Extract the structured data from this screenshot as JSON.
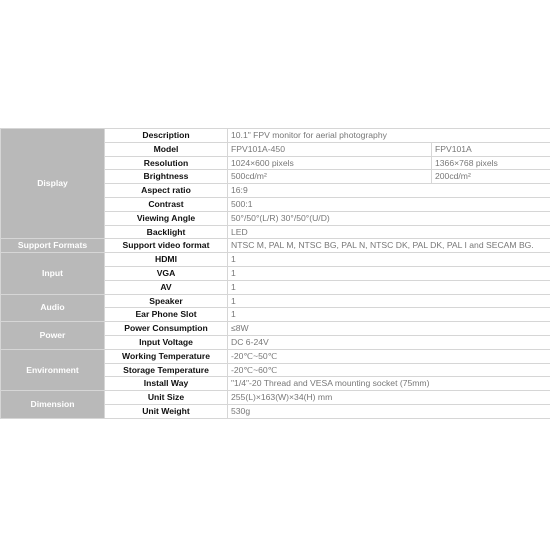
{
  "groups": {
    "display": "Display",
    "support_formats": "Support Formats",
    "input": "Input",
    "audio": "Audio",
    "power": "Power",
    "environment": "Environment",
    "dimension": "Dimension"
  },
  "rows": {
    "description": {
      "label": "Description",
      "value": "10.1\" FPV monitor for aerial photography"
    },
    "model": {
      "label": "Model",
      "value_a": "FPV101A-450",
      "value_b": "FPV101A"
    },
    "resolution": {
      "label": "Resolution",
      "value_a": "1024×600 pixels",
      "value_b": "1366×768 pixels"
    },
    "brightness": {
      "label": "Brightness",
      "value_a": "500cd/m²",
      "value_b": "200cd/m²"
    },
    "aspect_ratio": {
      "label": "Aspect ratio",
      "value": "16:9"
    },
    "contrast": {
      "label": "Contrast",
      "value": "500:1"
    },
    "viewing_angle": {
      "label": "Viewing Angle",
      "value": "50°/50°(L/R) 30°/50°(U/D)"
    },
    "backlight": {
      "label": "Backlight",
      "value": "LED"
    },
    "support_video_format": {
      "label": "Support video format",
      "value": "NTSC M, PAL M, NTSC BG, PAL N, NTSC DK, PAL DK, PAL I and SECAM BG."
    },
    "hdmi": {
      "label": "HDMI",
      "value": "1"
    },
    "vga": {
      "label": "VGA",
      "value": "1"
    },
    "av": {
      "label": "AV",
      "value": "1"
    },
    "speaker": {
      "label": "Speaker",
      "value": "1"
    },
    "ear_phone_slot": {
      "label": "Ear Phone Slot",
      "value": "1"
    },
    "power_consumption": {
      "label": "Power Consumption",
      "value": "≤8W"
    },
    "input_voltage": {
      "label": "Input Voltage",
      "value": "DC 6-24V"
    },
    "working_temperature": {
      "label": "Working Temperature",
      "value": "-20℃~50℃"
    },
    "storage_temperature": {
      "label": "Storage Temperature",
      "value": "-20℃~60℃"
    },
    "install_way": {
      "label": "Install Way",
      "value": "\"1/4\"-20 Thread and VESA mounting socket (75mm)"
    },
    "unit_size": {
      "label": "Unit Size",
      "value": "255(L)×163(W)×34(H) mm"
    },
    "unit_weight": {
      "label": "Unit Weight",
      "value": "530g"
    }
  }
}
